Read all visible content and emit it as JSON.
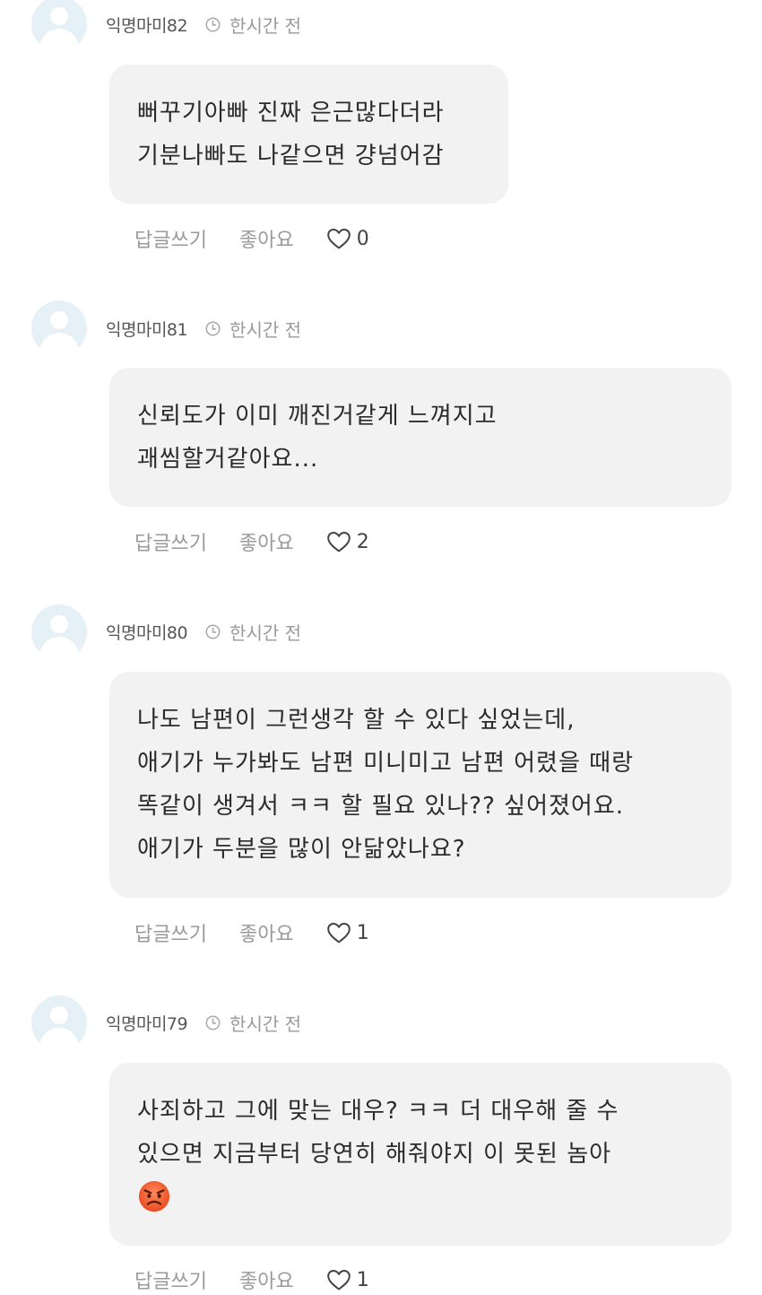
{
  "comments": [
    {
      "username": "익명마미82",
      "time": "한시간 전",
      "lines": [
        "뻐꾸기아빠 진짜 은근많다더라",
        "기분나빠도 나같으면 걍넘어감"
      ],
      "reply_label": "답글쓰기",
      "like_label": "좋아요",
      "likes": "0"
    },
    {
      "username": "익명마미81",
      "time": "한시간 전",
      "lines": [
        "신뢰도가 이미 깨진거같게 느껴지고",
        "괘씸할거같아요..."
      ],
      "reply_label": "답글쓰기",
      "like_label": "좋아요",
      "likes": "2"
    },
    {
      "username": "익명마미80",
      "time": "한시간 전",
      "lines": [
        "나도 남편이 그런생각 할 수 있다 싶었는데,",
        "애기가 누가봐도 남편 미니미고 남편 어렸을 때랑",
        "똑같이 생겨서 ㅋㅋ 할 필요 있나?? 싶어졌어요.",
        "애기가 두분을 많이 안닮았나요?"
      ],
      "reply_label": "답글쓰기",
      "like_label": "좋아요",
      "likes": "1"
    },
    {
      "username": "익명마미79",
      "time": "한시간 전",
      "lines": [
        "사죄하고 그에 맞는 대우? ㅋㅋ 더 대우해 줄 수",
        "있으면 지금부터 당연히 해줘야지 이 못된 놈아"
      ],
      "emoji": "angry-face",
      "reply_label": "답글쓰기",
      "like_label": "좋아요",
      "likes": "1"
    }
  ],
  "icons": {
    "clock": "clock-icon",
    "heart": "heart-outline-icon",
    "avatar": "default-avatar-icon"
  },
  "colors": {
    "bubble_bg": "#f2f2f2",
    "avatar_bg": "#e6f0f7",
    "meta_text": "#9a9a9a"
  }
}
